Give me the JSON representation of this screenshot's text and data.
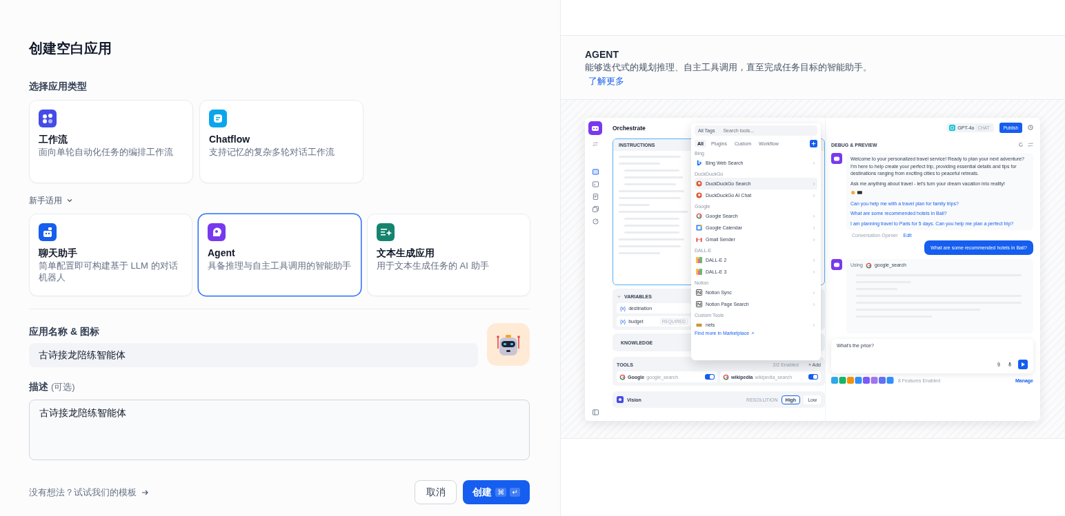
{
  "title": "创建空白应用",
  "type_section": {
    "label": "选择应用类型"
  },
  "app_types": [
    {
      "kind": "workflow",
      "title": "工作流",
      "description": "面向单轮自动化任务的编排工作流",
      "selected": false
    },
    {
      "kind": "chatflow",
      "title": "Chatflow",
      "description": "支持记忆的复杂多轮对话工作流",
      "selected": false
    }
  ],
  "beginner": {
    "label": "新手适用",
    "expanded": true
  },
  "beginner_types": [
    {
      "kind": "chat",
      "title": "聊天助手",
      "description": "简单配置即可构建基于 LLM 的对话机器人",
      "selected": false
    },
    {
      "kind": "agent",
      "title": "Agent",
      "description": "具备推理与自主工具调用的智能助手",
      "selected": true
    },
    {
      "kind": "text",
      "title": "文本生成应用",
      "description": "用于文本生成任务的 AI 助手",
      "selected": false
    }
  ],
  "name_section": {
    "label": "应用名称 & 图标",
    "value": "古诗接龙陪练智能体"
  },
  "description_section": {
    "label": "描述",
    "optional": "(可选)",
    "value": "古诗接龙陪练智能体"
  },
  "footer": {
    "template_link": "没有想法？试试我们的模板",
    "cancel": "取消",
    "create": "创建",
    "keys": [
      "⌘",
      "↵"
    ]
  },
  "preview": {
    "title": "AGENT",
    "description": "能够迭代式的规划推理、自主工具调用，直至完成任务目标的智能助手。",
    "learn_more": "了解更多",
    "screenshot": {
      "orchestrate": {
        "title": "Orchestrate",
        "instructions": "INSTRUCTIONS",
        "variables": {
          "label": "VARIABLES",
          "items": [
            {
              "prefix": "{x}",
              "name": "destination"
            },
            {
              "prefix": "{x}",
              "name": "budget",
              "badge": "REQUIRED"
            }
          ]
        },
        "knowledge": "KNOWLEDGE",
        "tools": {
          "label": "TOOLS",
          "count": "2/2 Enabled",
          "add": "+ Add",
          "items": [
            {
              "name": "Google",
              "id": "google_search",
              "on": true
            },
            {
              "name": "wikipedia",
              "id": "wikipedia_search",
              "on": true
            }
          ]
        },
        "vision": {
          "label": "Vision",
          "resolution": "RESOLUTION",
          "options": [
            {
              "label": "High",
              "selected": true
            },
            {
              "label": "Low",
              "selected": false
            }
          ]
        }
      },
      "tool_picker": {
        "filter": "All Tags",
        "placeholder": "Search tools...",
        "tabs": [
          {
            "label": "All",
            "selected": true
          },
          {
            "label": "Plugins",
            "selected": false
          },
          {
            "label": "Custom",
            "selected": false
          },
          {
            "label": "Workflow",
            "selected": false
          }
        ],
        "groups": [
          {
            "label": "Bing",
            "tools": [
              {
                "name": "Bing Web Search",
                "kind": "bing",
                "selected": false
              }
            ]
          },
          {
            "label": "DuckDuckGo",
            "tools": [
              {
                "name": "DuckDuckGo Search",
                "kind": "duck",
                "selected": true
              },
              {
                "name": "DuckDuckGo AI Chat",
                "kind": "duck",
                "selected": false
              }
            ]
          },
          {
            "label": "Google",
            "tools": [
              {
                "name": "Google Search",
                "kind": "google",
                "selected": false
              },
              {
                "name": "Google Calendar",
                "kind": "calendar",
                "selected": false
              },
              {
                "name": "Gmail Sender",
                "kind": "gmail",
                "selected": false
              }
            ]
          },
          {
            "label": "DALL-E",
            "tools": [
              {
                "name": "DALL-E 2",
                "kind": "dalle",
                "selected": false
              },
              {
                "name": "DALL-E 3",
                "kind": "dalle",
                "selected": false
              }
            ]
          },
          {
            "label": "Notion",
            "tools": [
              {
                "name": "Notion Sync",
                "kind": "notion",
                "selected": false
              },
              {
                "name": "Notion Page Search",
                "kind": "notion",
                "selected": false
              }
            ]
          },
          {
            "label": "Custom Tools",
            "tools": [
              {
                "name": "nets",
                "kind": "custom",
                "selected": false
              }
            ]
          }
        ],
        "footer_text": "Find more in",
        "footer_link": "Marketplace"
      },
      "debug": {
        "model": "GPT-4o",
        "model_badge": "CHAT",
        "publish": "Publish",
        "title": "DEBUG & PREVIEW",
        "welcome": [
          "Welcome to your personalized travel service! Ready to plan your next adventure? I'm here to help create your perfect trip, providing essential details and tips for destinations ranging from exciting cities to peaceful retreats.",
          "Ask me anything about travel - let's turn your dream vacation into reality!"
        ],
        "suggestions": [
          "Can you help me with a travel plan for family trips?",
          "What are some recommended hotels in Bali?",
          "I am planning travel to Paris for 5 days. Can you help me plan a perfect trip?"
        ],
        "opener": "Conversation Opener",
        "edit": "Edit",
        "user_message": "What are some recommended hotels in Bali?",
        "using": "Using",
        "using_tool": "google_search",
        "input": "What's the price?",
        "features": "8 Features Enabled",
        "manage": "Manage"
      }
    }
  }
}
